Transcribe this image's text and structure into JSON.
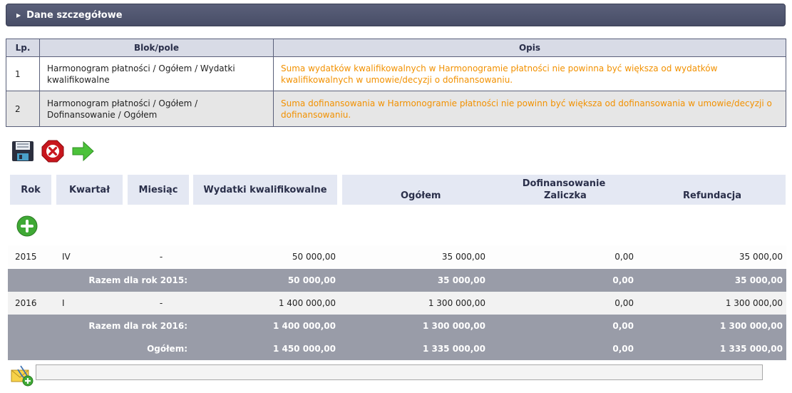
{
  "section": {
    "title": "Dane szczegółowe"
  },
  "validation_table": {
    "headers": {
      "lp": "Lp.",
      "blok": "Blok/pole",
      "opis": "Opis"
    },
    "rows": [
      {
        "lp": "1",
        "blok": "Harmonogram płatności / Ogółem / Wydatki kwalifikowalne",
        "opis": "Suma wydatków kwalifikowalnych w Harmonogramie płatności nie powinna być większa od wydatków kwalifikowalnych w umowie/decyzji o dofinansowaniu."
      },
      {
        "lp": "2",
        "blok": "Harmonogram płatności / Ogółem / Dofinansowanie / Ogółem",
        "opis": "Suma dofinansowania w Harmonogramie płatności nie powinn być większa od dofinansowania w umowie/decyzji o dofinansowaniu."
      }
    ]
  },
  "toolbar": {
    "icons": [
      "save-icon",
      "cancel-icon",
      "next-arrow-icon"
    ]
  },
  "schedule_header": {
    "rok": "Rok",
    "kwartal": "Kwartał",
    "miesiac": "Miesiąc",
    "wydatki": "Wydatki kwalifikowalne",
    "dofinansowanie": "Dofinansowanie",
    "ogolem": "Ogółem",
    "zaliczka": "Zaliczka",
    "refundacja": "Refundacja"
  },
  "rows": {
    "r2015": {
      "rok": "2015",
      "kwartal": "IV",
      "miesiac": "-",
      "wydatki": "50 000,00",
      "ogolem": "35 000,00",
      "zaliczka": "0,00",
      "refundacja": "35 000,00"
    },
    "sum2015": {
      "label": "Razem dla rok 2015:",
      "wydatki": "50 000,00",
      "ogolem": "35 000,00",
      "zaliczka": "0,00",
      "refundacja": "35 000,00"
    },
    "r2016": {
      "rok": "2016",
      "kwartal": "I",
      "miesiac": "-",
      "wydatki": "1 400 000,00",
      "ogolem": "1 300 000,00",
      "zaliczka": "0,00",
      "refundacja": "1 300 000,00"
    },
    "sum2016": {
      "label": "Razem dla rok 2016:",
      "wydatki": "1 400 000,00",
      "ogolem": "1 300 000,00",
      "zaliczka": "0,00",
      "refundacja": "1 300 000,00"
    },
    "total": {
      "label": "Ogółem:",
      "wydatki": "1 450 000,00",
      "ogolem": "1 335 000,00",
      "zaliczka": "0,00",
      "refundacja": "1 335 000,00"
    }
  },
  "colors": {
    "bar": "#484d66",
    "warning_text": "#f29100",
    "sum_row": "#999ca8",
    "header_bg": "#e4e8f3"
  }
}
